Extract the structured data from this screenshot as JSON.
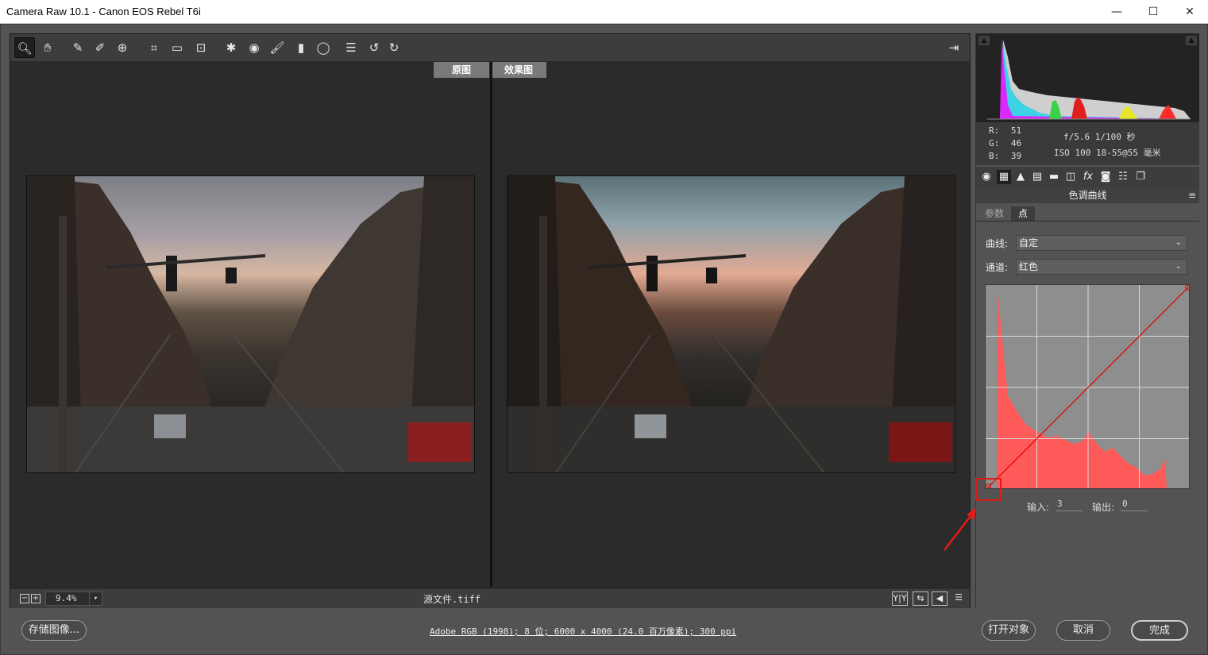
{
  "window": {
    "title": "Camera Raw 10.1 -  Canon EOS Rebel T6i",
    "min": "—",
    "max": "☐",
    "close": "✕"
  },
  "toolbar": {
    "tools": [
      "zoom-icon",
      "hand-icon",
      "white-balance-icon",
      "color-sampler-icon",
      "target-adjust-icon",
      "crop-icon",
      "straighten-icon",
      "transform-icon",
      "spot-removal-icon",
      "red-eye-icon",
      "adjustment-brush-icon",
      "graduated-filter-icon",
      "radial-filter-icon",
      "preferences-icon",
      "rotate-ccw-icon",
      "rotate-cw-icon"
    ]
  },
  "view": {
    "before_label": "原图",
    "after_label": "效果图"
  },
  "bottom": {
    "zoom": "9.4%",
    "filename": "源文件.tiff"
  },
  "histogram": {
    "r_label": "R:",
    "r": "51",
    "g_label": "G:",
    "g": "46",
    "b_label": "B:",
    "b": "39",
    "aperture_shutter": "f/5.6  1/100 秒",
    "iso_focal": "ISO 100  18-55@55 毫米"
  },
  "panel": {
    "title": "色调曲线",
    "subtabs": [
      "参数",
      "点"
    ],
    "curve_label": "曲线:",
    "curve_value": "自定",
    "channel_label": "通道:",
    "channel_value": "红色",
    "input_label": "输入:",
    "input_value": "3",
    "output_label": "输出:",
    "output_value": "0",
    "channel_color": "#ff5a5a"
  },
  "footer": {
    "save_label": "存储图像...",
    "info": "Adobe RGB (1998); 8 位; 6000 x 4000 (24.0 百万像素); 300 ppi",
    "open_label": "打开对象",
    "cancel_label": "取消",
    "done_label": "完成"
  }
}
